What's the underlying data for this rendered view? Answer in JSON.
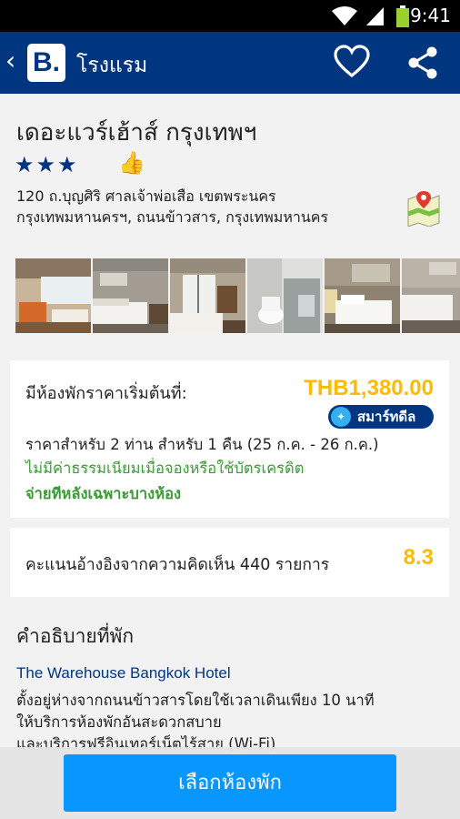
{
  "status_bar": {
    "time": "9:41"
  },
  "app_bar": {
    "logo_letter": "B.",
    "title": "โรงแรม"
  },
  "hotel": {
    "name": "เดอะแวร์เฮ้าส์ กรุงเทพฯ",
    "stars": "★★★",
    "star_count": 3,
    "address_line1": "120 ถ.บุญศิริ ศาลเจ้าพ่อเสือ เขตพระนคร",
    "address_line2": "กรุงเทพมหานครฯ, ถนนข้าวสาร, กรุงเทพมหานคร"
  },
  "photos_count": 6,
  "price_card": {
    "label": "มีห้องพักราคาเริ่มต้นที่:",
    "price": "THB1,380.00",
    "badge": "สมาร์ทดีล",
    "note": "ราคาสำหรับ 2 ท่าน สำหรับ 1 คืน (25 ก.ค. - 26 ก.ค.)",
    "no_fee": "ไม่มีค่าธรรมเนียมเมื่อจองหรือใช้บัตรเครดิต",
    "pay_later": "จ่ายทีหลังเฉพาะบางห้อง"
  },
  "score_card": {
    "label": "คะแนนอ้างอิงจากความคิดเห็น 440 รายการ",
    "score": "8.3"
  },
  "description": {
    "title": "คำอธิบายที่พัก",
    "hotel_name": "The Warehouse Bangkok Hotel",
    "line1": "ตั้งอยู่ห่างจากถนนข้าวสารโดยใช้เวลาเดินเพียง 10 นาที",
    "line2": "ให้บริการห้องพักอันสะดวกสบาย",
    "line3": "และบริการฟรีอินเทอร์เน็ตไร้สาย (Wi-Fi)"
  },
  "bottom": {
    "select_button": "เลือกห้องพัก"
  },
  "colors": {
    "brand": "#003580",
    "accent": "#febb02",
    "green": "#3c9a37",
    "button": "#0896ff"
  }
}
